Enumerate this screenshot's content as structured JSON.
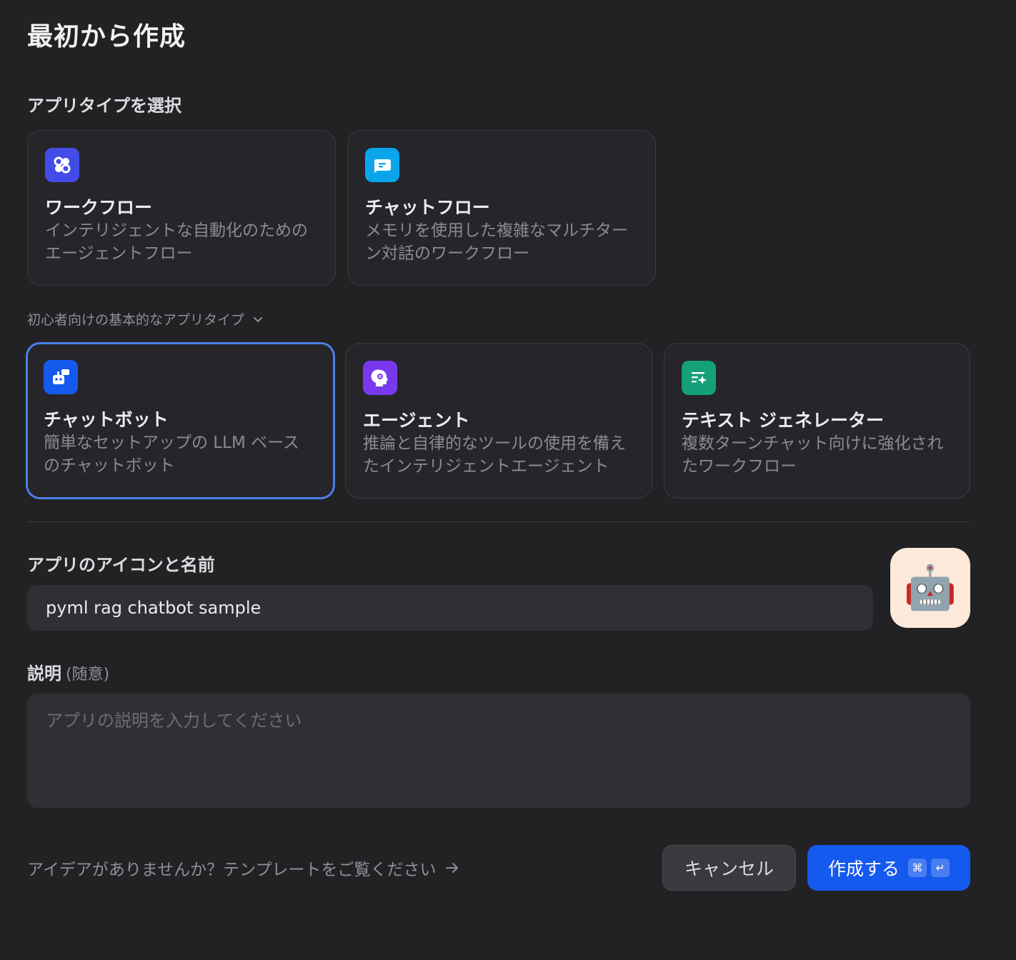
{
  "page_title": "最初から作成",
  "app_type_section": {
    "label": "アプリタイプを選択"
  },
  "advanced_types": [
    {
      "name": "ワークフロー",
      "desc": "インテリジェントな自動化のためのエージェントフロー",
      "icon": "workflow-icon",
      "color": "#444ce7"
    },
    {
      "name": "チャットフロー",
      "desc": "メモリを使用した複雑なマルチターン対話のワークフロー",
      "icon": "chatflow-icon",
      "color": "#0ba5ec"
    }
  ],
  "basic_toggle": {
    "label": "初心者向けの基本的なアプリタイプ",
    "icon": "chevron-down-icon"
  },
  "basic_types": [
    {
      "name": "チャットボット",
      "desc": "簡単なセットアップの LLM ベースのチャットボット",
      "icon": "chatbot-icon",
      "color": "#155aef",
      "selected": true
    },
    {
      "name": "エージェント",
      "desc": "推論と自律的なツールの使用を備えたインテリジェントエージェント",
      "icon": "agent-icon",
      "color": "#7839ee"
    },
    {
      "name": "テキスト ジェネレーター",
      "desc": "複数ターンチャット向けに強化されたワークフロー",
      "icon": "text-generator-icon",
      "color": "#15a07a"
    }
  ],
  "name_section": {
    "label": "アプリのアイコンと名前",
    "value": "pyml rag chatbot sample",
    "icon": "robot-emoji",
    "icon_char": "🤖",
    "icon_bg": "#fde9da"
  },
  "description_section": {
    "label": "説明",
    "optional": "(随意)",
    "placeholder": "アプリの説明を入力してください"
  },
  "template_link": {
    "label": "アイデアがありませんか？テンプレートをご覧ください",
    "icon": "arrow-right-icon"
  },
  "buttons": {
    "cancel": "キャンセル",
    "create": "作成する",
    "shortcut_cmd": "⌘",
    "shortcut_enter": "↵"
  }
}
